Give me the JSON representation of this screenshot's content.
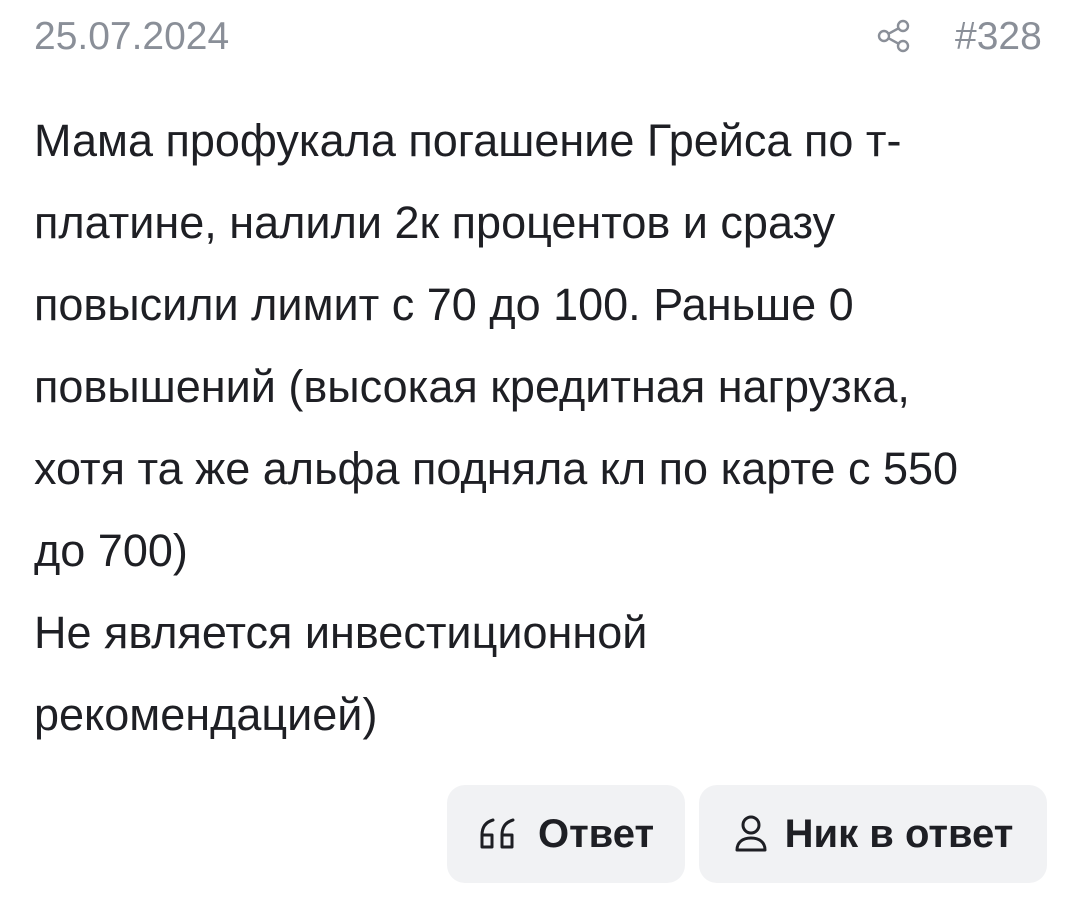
{
  "post": {
    "date": "25.07.2024",
    "number": "#328",
    "lines": [
      "Мама профукала погашение Грейса по т-",
      "платине, налили 2к процентов и сразу",
      "повысили лимит с 70 до 100. Раньше 0",
      "повышений (высокая кредитная нагрузка,",
      "хотя та же альфа подняла кл по карте с 550",
      "до 700)",
      "Не является инвестиционной",
      "рекомендацией)"
    ]
  },
  "actions": {
    "reply_label": "Ответ",
    "nick_reply_label": "Ник в ответ"
  },
  "icons": {
    "share": "share-icon",
    "quote": "quote-icon",
    "user": "user-icon"
  },
  "colors": {
    "meta_text": "#8a8f98",
    "body_text": "#1e1f24",
    "button_bg": "#f1f2f4"
  }
}
